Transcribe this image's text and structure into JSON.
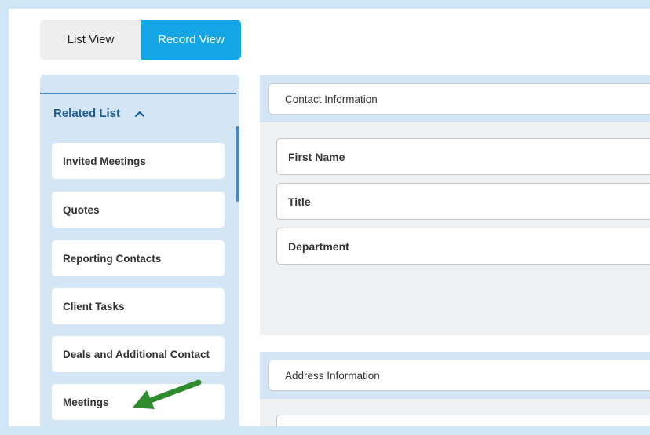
{
  "view_toggle": {
    "list_label": "List View",
    "record_label": "Record View",
    "active": "Record View"
  },
  "sidebar": {
    "header": "Related List",
    "items": [
      {
        "label": "Invited Meetings"
      },
      {
        "label": "Quotes"
      },
      {
        "label": "Reporting Contacts"
      },
      {
        "label": "Client Tasks"
      },
      {
        "label": "Deals and Additional Contact"
      },
      {
        "label": "Meetings"
      }
    ]
  },
  "main": {
    "contact_section": {
      "title": "Contact Information",
      "fields": [
        {
          "label": "First Name"
        },
        {
          "label": "Title"
        },
        {
          "label": "Department"
        }
      ]
    },
    "address_section": {
      "title": "Address Information"
    }
  },
  "colors": {
    "accent": "#14a5e6",
    "sidebar_bg": "#d4e6f5",
    "header_text": "#1d5d95",
    "annotation_arrow": "#2e8b2e"
  },
  "icons": {
    "collapse": "chevron-up-icon",
    "annotation": "green-arrow-icon"
  }
}
